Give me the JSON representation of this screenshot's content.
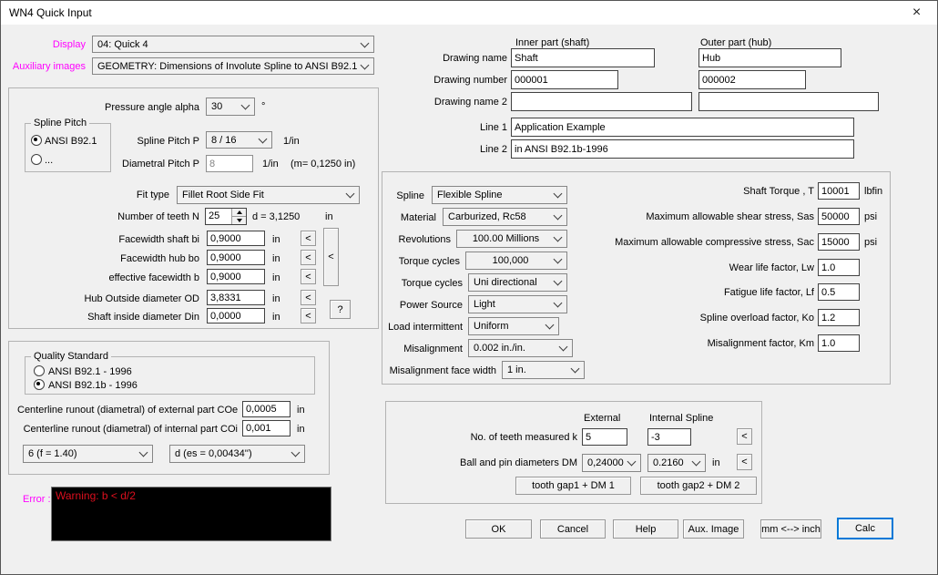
{
  "window": {
    "title": "WN4 Quick Input",
    "close_glyph": "×"
  },
  "colors": {
    "label_magenta": "#FF00FF",
    "accent_blue": "#0078D7",
    "error_red": "#DD0F1E",
    "error_bg": "#000000"
  },
  "header": {
    "display_label": "Display",
    "display_value": "04: Quick 4",
    "aux_images_label": "Auxiliary images",
    "aux_images_value": "GEOMETRY: Dimensions of Involute Spline to ANSI B92.1"
  },
  "geometry": {
    "pressure_angle_label": "Pressure angle alpha",
    "pressure_angle_value": "30",
    "degree_unit": "°",
    "spline_pitch_group_title": "Spline Pitch",
    "spline_pitch_radio_ansi": "ANSI B92.1",
    "spline_pitch_radio_other": "...",
    "spline_pitch_label": "Spline Pitch P",
    "spline_pitch_value": "8 / 16",
    "per_inch_unit": "1/in",
    "diametral_pitch_label": "Diametral Pitch P",
    "diametral_pitch_value": "8",
    "module_note": "(m= 0,1250 in)",
    "fit_type_label": "Fit type",
    "fit_type_value": "Fillet Root Side Fit",
    "teeth_label": "Number of teeth N",
    "teeth_value": "25",
    "pitch_dia_note": "d =  3,1250",
    "inch_unit": "in",
    "rows": [
      {
        "label": "Facewidth shaft bi",
        "value": "0,9000",
        "unit": "in"
      },
      {
        "label": "Facewidth hub bo",
        "value": "0,9000",
        "unit": "in"
      },
      {
        "label": "effective facewidth b",
        "value": "0,9000",
        "unit": "in"
      },
      {
        "label": "Hub Outside diameter OD",
        "value": "3,8331",
        "unit": "in"
      },
      {
        "label": "Shaft inside diameter  Din",
        "value": "0,0000",
        "unit": "in"
      }
    ],
    "take_button": "<",
    "help_button": "?"
  },
  "quality": {
    "group_title": "Quality Standard",
    "radio_1": "ANSI B92.1 - 1996",
    "radio_2": "ANSI B92.1b - 1996",
    "coe_label": "Centerline runout (diametral) of external part  COe",
    "coe_value": "0,0005",
    "coi_label": "Centerline runout (diametral) of internal part  COi",
    "coi_value": "0,001",
    "unit": "in",
    "tolerance_class_value": "6 (f = 1.40)",
    "fit_letter_value": "d (es = 0,00434'')"
  },
  "error": {
    "label": "Error  :",
    "message": "Warning: b < d/2"
  },
  "drawing": {
    "inner_header": "Inner part (shaft)",
    "outer_header": "Outer part (hub)",
    "name_label": "Drawing name",
    "name_inner": "Shaft",
    "name_outer": "Hub",
    "number_label": "Drawing number",
    "number_inner": "000001",
    "number_outer": "000002",
    "name2_label": "Drawing name 2",
    "name2_inner": "",
    "name2_outer": "",
    "line1_label": "Line 1",
    "line1_value": "Application Example",
    "line2_label": "Line 2",
    "line2_value": "in ANSI B92.1b-1996"
  },
  "application": {
    "rows": [
      {
        "label": "Spline",
        "value": "Flexible Spline"
      },
      {
        "label": "Material",
        "value": "Carburized, Rc58"
      },
      {
        "label": "Revolutions",
        "value": "100.00 Millions"
      },
      {
        "label": "Torque cycles",
        "value": "100,000"
      },
      {
        "label": "Torque cycles",
        "value": "Uni directional"
      },
      {
        "label": "Power Source",
        "value": "Light"
      },
      {
        "label": "Load intermittent",
        "value": "Uniform"
      },
      {
        "label": "Misalignment",
        "value": "0.002 in./in."
      },
      {
        "label": "Misalignment face width",
        "value": "1 in."
      }
    ],
    "params": [
      {
        "label": "Shaft Torque , T",
        "value": "10001",
        "unit": "lbfin"
      },
      {
        "label": "Maximum allowable shear stress, Sas",
        "value": "50000",
        "unit": "psi"
      },
      {
        "label": "Maximum allowable compressive stress, Sac",
        "value": "15000",
        "unit": "psi"
      },
      {
        "label": "Wear life factor, Lw",
        "value": "1.0",
        "unit": ""
      },
      {
        "label": "Fatigue life factor, Lf",
        "value": "0.5",
        "unit": ""
      },
      {
        "label": "Spline overload factor, Ko",
        "value": "1.2",
        "unit": ""
      },
      {
        "label": "Misalignment factor, Km",
        "value": "1.0",
        "unit": ""
      }
    ]
  },
  "measurement": {
    "external_header": "External",
    "internal_header": "Internal Spline",
    "teeth_measured_label": "No. of teeth measured k",
    "teeth_measured_external": "5",
    "teeth_measured_internal": "-3",
    "ball_pin_label": "Ball and pin diameters DM",
    "ball_pin_external": "0,24000",
    "ball_pin_internal": "0.2160",
    "unit": "in",
    "take_button": "<",
    "tooth_gap1_button": "tooth gap1 + DM 1",
    "tooth_gap2_button": "tooth gap2 + DM 2"
  },
  "footer": {
    "ok": "OK",
    "cancel": "Cancel",
    "help": "Help",
    "aux_image": "Aux. Image",
    "mm_inch": "mm <--> inch",
    "calc": "Calc"
  }
}
